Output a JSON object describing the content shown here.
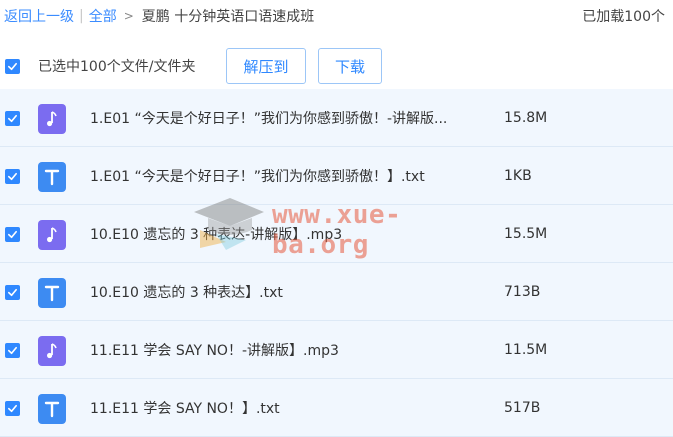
{
  "breadcrumb": {
    "back": "返回上一级",
    "separator": "|",
    "all": "全部",
    "arrow": ">",
    "current": "夏鹏 十分钟英语口语速成班"
  },
  "loaded_status": "已加载100个",
  "toolbar": {
    "selection_text": "已选中100个文件/文件夹",
    "extract_label": "解压到",
    "download_label": "下载"
  },
  "files": [
    {
      "name": "1.E01 “今天是个好日子！”我们为你感到骄傲！-讲解版...",
      "size": "15.8M",
      "icon": "audio-file-icon"
    },
    {
      "name": "1.E01 “今天是个好日子！”我们为你感到骄傲！】.txt",
      "size": "1KB",
      "icon": "text-file-icon"
    },
    {
      "name": "10.E10 遗忘的 3 种表达-讲解版】.mp3",
      "size": "15.5M",
      "icon": "audio-file-icon"
    },
    {
      "name": "10.E10 遗忘的 3 种表达】.txt",
      "size": "713B",
      "icon": "text-file-icon"
    },
    {
      "name": "11.E11 学会 SAY NO！-讲解版】.mp3",
      "size": "11.5M",
      "icon": "audio-file-icon"
    },
    {
      "name": "11.E11 学会 SAY NO！】.txt",
      "size": "517B",
      "icon": "text-file-icon"
    }
  ],
  "watermark": "www.xue-ba.org",
  "colors": {
    "accent": "#2f88ff",
    "row_bg": "#f1f7fe",
    "audio_icon": "#7b6cf0",
    "text_icon": "#3d8bf2"
  }
}
